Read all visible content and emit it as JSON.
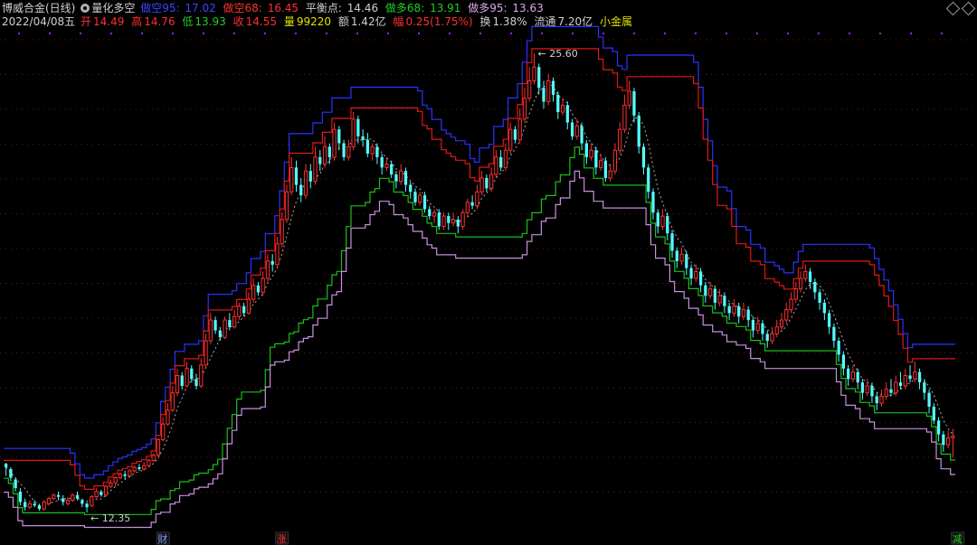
{
  "header": {
    "stock_title": "博威合金(日线)",
    "indicator_name": "量化多空",
    "lines": [
      {
        "label": "做空95: ",
        "value": "17.02",
        "color": "#3a45ff"
      },
      {
        "label": "做空68: ",
        "value": "16.45",
        "color": "#ff3030"
      },
      {
        "label": "平衡点: ",
        "value": "14.46",
        "color": "#cfcfcf"
      },
      {
        "label": "做多68: ",
        "value": "13.91",
        "color": "#22cc22"
      },
      {
        "label": "做多95: ",
        "value": "13.63",
        "color": "#d8a8e8"
      }
    ],
    "quote": {
      "date": "2022/04/08五",
      "open_label": "开",
      "open": "14.49",
      "high_label": "高",
      "high": "14.76",
      "low_label": "低",
      "low": "13.93",
      "close_label": "收",
      "close": "14.55",
      "volume_label": "量",
      "volume": "99220",
      "amount_label": "额",
      "amount": "1.42亿",
      "change_label": "幅",
      "change": "0.25(1.75%)",
      "turnover_label": "换",
      "turnover": "1.38%",
      "float_label": "流通",
      "float": "7.20亿",
      "sector": "小金属"
    }
  },
  "markers": [
    {
      "text": "财",
      "color": "#7aa0ff",
      "day": 33
    },
    {
      "text": "涨",
      "color": "#ff3030",
      "day": 58
    },
    {
      "text": "减",
      "color": "#22cc22",
      "day": 200
    }
  ],
  "colors": {
    "up": "#ff3030",
    "down": "#54fcfc",
    "short95": "#2a32ff",
    "short68": "#e01818",
    "long68": "#19c019",
    "long95": "#c890dc",
    "balance": "#bdbdbd",
    "dots": "#a020f0",
    "grid": "#7a1010"
  },
  "chart_data": {
    "type": "candlestick",
    "stock": "博威合金(日线)",
    "ylim": [
      11.8,
      26.3
    ],
    "max_label": "25.60",
    "min_label": "12.35",
    "candles": [
      [
        13.75,
        13.65,
        13.78,
        13.4
      ],
      [
        13.6,
        13.35,
        13.65,
        13.25
      ],
      [
        13.3,
        13.05,
        13.35,
        12.95
      ],
      [
        12.95,
        12.65,
        13.05,
        12.55
      ],
      [
        12.65,
        12.5,
        12.75,
        12.4
      ],
      [
        12.5,
        12.6,
        12.7,
        12.45
      ],
      [
        12.6,
        12.55,
        12.7,
        12.5
      ],
      [
        12.55,
        12.45,
        12.6,
        12.4
      ],
      [
        12.45,
        12.65,
        12.7,
        12.4
      ],
      [
        12.6,
        12.75,
        12.8,
        12.55
      ],
      [
        12.75,
        12.85,
        12.9,
        12.7
      ],
      [
        12.85,
        12.8,
        12.95,
        12.7
      ],
      [
        12.75,
        12.65,
        12.85,
        12.55
      ],
      [
        12.6,
        12.7,
        12.8,
        12.55
      ],
      [
        12.7,
        12.85,
        12.9,
        12.65
      ],
      [
        12.85,
        12.75,
        12.95,
        12.7
      ],
      [
        12.7,
        12.6,
        12.75,
        12.5
      ],
      [
        12.6,
        12.5,
        12.65,
        12.35
      ],
      [
        12.55,
        12.8,
        12.85,
        12.5
      ],
      [
        12.8,
        12.95,
        13.05,
        12.75
      ],
      [
        12.95,
        12.85,
        13.0,
        12.8
      ],
      [
        12.85,
        13.1,
        13.15,
        12.8
      ],
      [
        13.1,
        13.2,
        13.3,
        13.05
      ],
      [
        13.2,
        13.35,
        13.4,
        13.1
      ],
      [
        13.35,
        13.45,
        13.5,
        13.3
      ],
      [
        13.45,
        13.4,
        13.55,
        13.3
      ],
      [
        13.4,
        13.55,
        13.6,
        13.35
      ],
      [
        13.55,
        13.65,
        13.7,
        13.5
      ],
      [
        13.65,
        13.6,
        13.75,
        13.55
      ],
      [
        13.6,
        13.7,
        13.8,
        13.55
      ],
      [
        13.7,
        13.85,
        13.9,
        13.65
      ],
      [
        13.85,
        14.0,
        14.05,
        13.8
      ],
      [
        14.0,
        14.45,
        14.5,
        13.95
      ],
      [
        14.45,
        14.9,
        15.1,
        14.4
      ],
      [
        14.9,
        15.3,
        15.5,
        14.85
      ],
      [
        15.3,
        15.8,
        16.0,
        15.25
      ],
      [
        15.8,
        16.3,
        16.5,
        15.7
      ],
      [
        16.3,
        16.0,
        16.4,
        15.9
      ],
      [
        16.0,
        16.5,
        16.7,
        15.95
      ],
      [
        16.5,
        16.2,
        16.6,
        16.1
      ],
      [
        16.2,
        16.0,
        16.35,
        15.9
      ],
      [
        16.0,
        16.6,
        16.8,
        15.95
      ],
      [
        16.6,
        17.3,
        17.5,
        16.55
      ],
      [
        17.3,
        17.9,
        18.1,
        17.2
      ],
      [
        17.9,
        17.6,
        18.0,
        17.5
      ],
      [
        17.6,
        17.4,
        17.7,
        17.3
      ],
      [
        17.4,
        17.9,
        18.0,
        17.35
      ],
      [
        17.9,
        17.7,
        18.1,
        17.6
      ],
      [
        17.7,
        18.0,
        18.2,
        17.65
      ],
      [
        18.0,
        18.3,
        18.4,
        17.9
      ],
      [
        18.3,
        18.1,
        18.4,
        18.0
      ],
      [
        18.1,
        18.5,
        18.7,
        18.05
      ],
      [
        18.5,
        18.9,
        19.1,
        18.4
      ],
      [
        18.9,
        18.7,
        19.0,
        18.6
      ],
      [
        18.7,
        19.1,
        19.3,
        18.6
      ],
      [
        19.1,
        19.6,
        19.8,
        19.0
      ],
      [
        19.6,
        19.5,
        19.8,
        19.3
      ],
      [
        19.5,
        20.1,
        20.3,
        19.4
      ],
      [
        20.1,
        20.8,
        21.0,
        20.0
      ],
      [
        20.8,
        21.6,
        21.8,
        20.7
      ],
      [
        21.6,
        22.3,
        22.6,
        21.5
      ],
      [
        22.3,
        21.8,
        22.5,
        21.6
      ],
      [
        21.8,
        21.5,
        22.0,
        21.3
      ],
      [
        21.5,
        22.2,
        22.4,
        21.4
      ],
      [
        22.2,
        21.9,
        22.4,
        21.7
      ],
      [
        21.9,
        22.6,
        22.9,
        21.8
      ],
      [
        22.6,
        22.4,
        22.8,
        22.2
      ],
      [
        22.4,
        22.9,
        23.2,
        22.3
      ],
      [
        22.9,
        22.6,
        23.0,
        22.4
      ],
      [
        22.6,
        23.4,
        23.6,
        22.5
      ],
      [
        23.4,
        23.0,
        23.5,
        22.8
      ],
      [
        23.0,
        22.6,
        23.1,
        22.5
      ],
      [
        22.6,
        22.9,
        23.1,
        22.5
      ],
      [
        22.9,
        23.7,
        23.9,
        22.8
      ],
      [
        23.7,
        23.2,
        23.8,
        23.0
      ],
      [
        23.2,
        23.1,
        23.4,
        22.9
      ],
      [
        23.1,
        22.7,
        23.3,
        22.6
      ],
      [
        22.7,
        22.9,
        23.0,
        22.5
      ],
      [
        22.9,
        22.6,
        23.0,
        22.4
      ],
      [
        22.6,
        22.3,
        22.7,
        22.1
      ],
      [
        22.3,
        22.4,
        22.6,
        22.2
      ],
      [
        22.4,
        22.1,
        22.5,
        22.0
      ],
      [
        22.1,
        21.9,
        22.2,
        21.7
      ],
      [
        21.9,
        22.2,
        22.4,
        21.8
      ],
      [
        22.2,
        21.8,
        22.3,
        21.6
      ],
      [
        21.8,
        21.6,
        21.9,
        21.4
      ],
      [
        21.6,
        21.3,
        21.7,
        21.2
      ],
      [
        21.3,
        21.5,
        21.6,
        21.2
      ],
      [
        21.5,
        21.1,
        21.6,
        21.0
      ],
      [
        21.1,
        20.9,
        21.2,
        20.8
      ],
      [
        20.9,
        21.0,
        21.1,
        20.7
      ],
      [
        21.0,
        20.6,
        21.1,
        20.5
      ],
      [
        20.6,
        20.9,
        21.0,
        20.5
      ],
      [
        20.9,
        20.7,
        21.0,
        20.5
      ],
      [
        20.7,
        20.8,
        21.0,
        20.6
      ],
      [
        20.8,
        20.6,
        20.9,
        20.4
      ],
      [
        20.6,
        21.0,
        21.1,
        20.5
      ],
      [
        21.0,
        21.3,
        21.4,
        20.9
      ],
      [
        21.3,
        21.2,
        21.5,
        21.1
      ],
      [
        21.2,
        21.6,
        21.8,
        21.1
      ],
      [
        21.6,
        22.0,
        22.2,
        21.5
      ],
      [
        22.0,
        21.7,
        22.1,
        21.6
      ],
      [
        21.7,
        22.1,
        22.3,
        21.6
      ],
      [
        22.1,
        22.6,
        22.8,
        22.0
      ],
      [
        22.6,
        22.3,
        22.8,
        22.2
      ],
      [
        22.3,
        22.8,
        23.0,
        22.2
      ],
      [
        22.8,
        23.4,
        23.6,
        22.7
      ],
      [
        23.4,
        23.1,
        23.5,
        23.0
      ],
      [
        23.1,
        23.7,
        24.0,
        23.0
      ],
      [
        23.7,
        24.3,
        24.6,
        23.6
      ],
      [
        24.3,
        24.8,
        25.2,
        24.2
      ],
      [
        24.8,
        25.2,
        25.6,
        24.7
      ],
      [
        25.2,
        24.6,
        25.3,
        24.4
      ],
      [
        24.6,
        24.2,
        24.8,
        24.0
      ],
      [
        24.2,
        24.8,
        25.0,
        24.1
      ],
      [
        24.8,
        24.4,
        24.9,
        24.2
      ],
      [
        24.4,
        23.9,
        24.5,
        23.7
      ],
      [
        23.9,
        24.1,
        24.3,
        23.8
      ],
      [
        24.1,
        23.6,
        24.2,
        23.4
      ],
      [
        23.6,
        23.2,
        23.7,
        23.1
      ],
      [
        23.2,
        23.5,
        23.7,
        23.1
      ],
      [
        23.5,
        23.0,
        23.6,
        22.8
      ],
      [
        23.0,
        22.6,
        23.1,
        22.4
      ],
      [
        22.6,
        22.8,
        23.0,
        22.5
      ],
      [
        22.8,
        22.3,
        22.9,
        22.1
      ],
      [
        22.3,
        22.5,
        22.7,
        22.2
      ],
      [
        22.5,
        22.0,
        22.6,
        21.9
      ],
      [
        22.0,
        22.2,
        22.4,
        21.9
      ],
      [
        22.2,
        22.8,
        23.0,
        22.1
      ],
      [
        22.8,
        23.4,
        23.6,
        22.7
      ],
      [
        23.4,
        24.1,
        24.4,
        23.3
      ],
      [
        24.1,
        24.5,
        24.8,
        24.0
      ],
      [
        24.5,
        23.8,
        24.6,
        23.6
      ],
      [
        23.8,
        22.9,
        23.9,
        22.7
      ],
      [
        22.9,
        22.3,
        23.0,
        22.1
      ],
      [
        22.3,
        21.6,
        22.4,
        21.4
      ],
      [
        21.6,
        21.0,
        21.7,
        20.8
      ],
      [
        21.0,
        20.6,
        21.1,
        20.4
      ],
      [
        20.6,
        20.9,
        21.1,
        20.5
      ],
      [
        20.9,
        20.4,
        21.0,
        20.2
      ],
      [
        20.4,
        19.9,
        20.5,
        19.7
      ],
      [
        19.9,
        19.6,
        20.0,
        19.4
      ],
      [
        19.6,
        19.8,
        20.0,
        19.5
      ],
      [
        19.8,
        19.4,
        19.9,
        19.2
      ],
      [
        19.4,
        19.1,
        19.5,
        18.9
      ],
      [
        19.1,
        19.3,
        19.5,
        19.0
      ],
      [
        19.3,
        18.9,
        19.4,
        18.7
      ],
      [
        18.9,
        18.6,
        19.0,
        18.4
      ],
      [
        18.6,
        18.8,
        19.0,
        18.5
      ],
      [
        18.8,
        18.4,
        18.9,
        18.2
      ],
      [
        18.4,
        18.6,
        18.8,
        18.3
      ],
      [
        18.6,
        18.3,
        18.7,
        18.1
      ],
      [
        18.3,
        18.1,
        18.4,
        17.9
      ],
      [
        18.1,
        18.3,
        18.5,
        18.0
      ],
      [
        18.3,
        18.0,
        18.4,
        17.8
      ],
      [
        18.0,
        18.2,
        18.4,
        17.9
      ],
      [
        18.2,
        17.9,
        18.3,
        17.7
      ],
      [
        17.9,
        17.6,
        18.0,
        17.4
      ],
      [
        17.6,
        17.8,
        18.0,
        17.5
      ],
      [
        17.8,
        17.5,
        17.9,
        17.3
      ],
      [
        17.5,
        17.3,
        17.6,
        17.1
      ],
      [
        17.3,
        17.5,
        17.7,
        17.2
      ],
      [
        17.5,
        17.7,
        17.9,
        17.4
      ],
      [
        17.7,
        17.9,
        18.1,
        17.6
      ],
      [
        17.9,
        18.2,
        18.4,
        17.8
      ],
      [
        18.2,
        18.5,
        18.7,
        18.1
      ],
      [
        18.5,
        18.8,
        19.0,
        18.4
      ],
      [
        18.8,
        19.1,
        19.3,
        18.7
      ],
      [
        19.1,
        19.3,
        19.5,
        19.0
      ],
      [
        19.3,
        19.0,
        19.4,
        18.8
      ],
      [
        19.0,
        18.7,
        19.1,
        18.5
      ],
      [
        18.7,
        18.4,
        18.8,
        18.2
      ],
      [
        18.4,
        18.1,
        18.5,
        17.9
      ],
      [
        18.1,
        17.7,
        18.2,
        17.5
      ],
      [
        17.7,
        17.3,
        17.8,
        17.1
      ],
      [
        17.3,
        16.9,
        17.4,
        16.7
      ],
      [
        16.9,
        16.5,
        17.0,
        16.3
      ],
      [
        16.5,
        16.2,
        16.6,
        16.0
      ],
      [
        16.2,
        16.4,
        16.6,
        16.1
      ],
      [
        16.4,
        16.1,
        16.5,
        15.9
      ],
      [
        16.1,
        15.8,
        16.2,
        15.6
      ],
      [
        15.8,
        16.0,
        16.2,
        15.7
      ],
      [
        16.0,
        15.7,
        16.1,
        15.5
      ],
      [
        15.7,
        15.5,
        15.8,
        15.3
      ],
      [
        15.5,
        15.7,
        15.9,
        15.4
      ],
      [
        15.7,
        15.9,
        16.1,
        15.6
      ],
      [
        15.9,
        15.8,
        16.2,
        15.7
      ],
      [
        15.8,
        16.1,
        16.3,
        15.7
      ],
      [
        16.1,
        16.0,
        16.4,
        15.9
      ],
      [
        16.0,
        16.3,
        16.5,
        15.9
      ],
      [
        16.3,
        16.2,
        16.6,
        16.1
      ],
      [
        16.2,
        16.4,
        16.7,
        16.1
      ],
      [
        16.4,
        16.1,
        16.5,
        15.9
      ],
      [
        16.1,
        15.8,
        16.2,
        15.6
      ],
      [
        15.8,
        15.4,
        15.9,
        15.2
      ],
      [
        15.4,
        15.0,
        15.5,
        14.9
      ],
      [
        15.0,
        14.6,
        15.1,
        14.4
      ],
      [
        14.6,
        14.3,
        14.7,
        14.1
      ],
      [
        14.3,
        14.5,
        14.7,
        14.2
      ],
      [
        14.5,
        14.55,
        14.76,
        13.93
      ]
    ],
    "short95": [],
    "short68": [],
    "long68": [],
    "long95": []
  }
}
